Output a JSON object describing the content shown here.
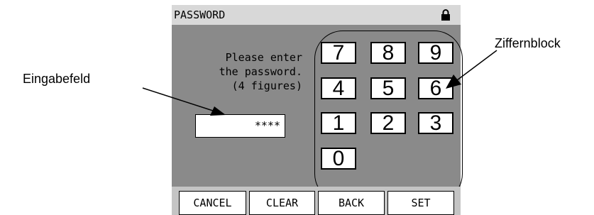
{
  "annotations": {
    "input_field_label": "Eingabefeld",
    "keypad_label": "Ziffernblock"
  },
  "title_bar": {
    "title": "PASSWORD",
    "icon": "lock-icon"
  },
  "prompt": {
    "line1": "Please enter",
    "line2": "the password.",
    "line3": "(4 figures)"
  },
  "password_field": {
    "value": "****"
  },
  "keypad": {
    "keys": [
      "7",
      "8",
      "9",
      "4",
      "5",
      "6",
      "1",
      "2",
      "3",
      "0"
    ]
  },
  "softkeys": {
    "cancel": "CANCEL",
    "clear": "CLEAR",
    "back": "BACK",
    "set": "SET"
  },
  "colors": {
    "screen_background": "#8a8a8a",
    "title_bar": "#d8d8d8",
    "bottom_bar": "#c4c4c4",
    "key_background": "#ffffff"
  }
}
